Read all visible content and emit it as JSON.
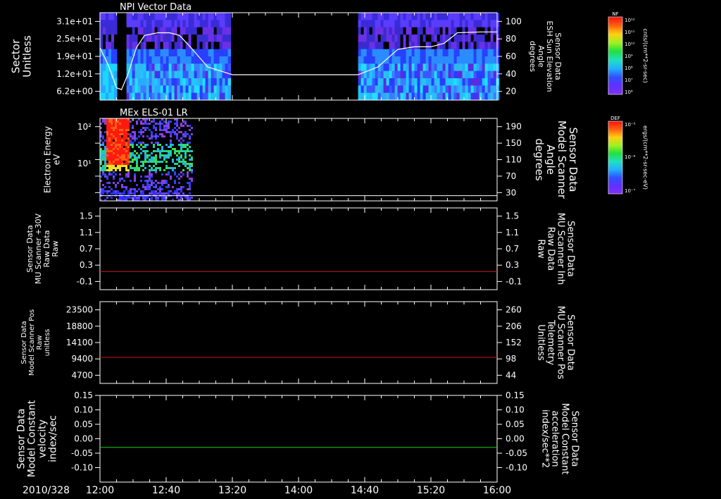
{
  "date_label": "2010/328",
  "time_ticks": [
    "12:00",
    "12:40",
    "13:20",
    "14:00",
    "14:40",
    "15:20",
    "16:00"
  ],
  "colors": {
    "frame": "#ffffff",
    "red_line": "#d01818",
    "green_line": "#10d010",
    "red_label": "#ff2020",
    "green_label": "#20e020"
  },
  "colorbars": [
    {
      "name": "npi-colorbar",
      "tag": "NF",
      "label": "cnts/(cm**2-sr-sec)",
      "ticks": [
        "10¹²",
        "10¹¹",
        "10¹⁰",
        "10⁹",
        "10⁸",
        "10⁷",
        "10⁶"
      ]
    },
    {
      "name": "els-colorbar",
      "tag": "DEF",
      "label": "ergs/(cm**2-sr-sec-eV)",
      "ticks": [
        "10⁻⁵",
        "10⁻⁶",
        "10⁻⁷"
      ]
    }
  ],
  "chart_data": [
    {
      "id": "npi-panel",
      "type": "heatmap",
      "title": "NPI Vector Data",
      "ylabel": [
        "Sector",
        "Unitless"
      ],
      "yticks": [
        "3.1e+01",
        "2.5e+01",
        "1.9e+01",
        "1.2e+01",
        "6.2e+00"
      ],
      "right_axis": {
        "label": [
          "Sensor Data",
          "ESH Sun Elevation",
          "Angle",
          "degrees"
        ],
        "ticks": [
          "100",
          "80",
          "60",
          "40",
          "20"
        ],
        "ylim": [
          0,
          100
        ]
      },
      "data_coverage": [
        [
          "12:00",
          "12:09"
        ],
        [
          "12:16",
          "13:18"
        ],
        [
          "14:36",
          "16:00"
        ]
      ],
      "series": [
        {
          "name": "sun-elevation",
          "x": [
            "12:00",
            "12:05",
            "12:10",
            "12:13",
            "12:17",
            "12:22",
            "12:27",
            "12:35",
            "12:42",
            "12:48",
            "12:55",
            "13:05",
            "13:20",
            "13:40",
            "14:00",
            "14:20",
            "14:36",
            "14:48",
            "15:00",
            "15:10",
            "15:20",
            "15:28",
            "15:36",
            "15:50",
            "16:00"
          ],
          "y": [
            60,
            40,
            14,
            12,
            30,
            60,
            74,
            77,
            77,
            74,
            60,
            38,
            29,
            29,
            29,
            29,
            29,
            38,
            58,
            61,
            61,
            65,
            77,
            78,
            78
          ]
        }
      ]
    },
    {
      "id": "els-panel",
      "type": "heatmap",
      "title": "MEx ELS-01 LR",
      "ylabel": [
        "Electron Energy",
        "eV"
      ],
      "yticks": [
        "10²",
        "10¹"
      ],
      "yscale": "log",
      "right_axis": {
        "label": [
          "Sensor Data",
          "Model Scanner",
          "Angle",
          "degrees"
        ],
        "ticks": [
          "190",
          "150",
          "110",
          "70",
          "30"
        ],
        "ylim": [
          0,
          190
        ]
      },
      "data_coverage": [
        [
          "12:00",
          "12:56"
        ]
      ],
      "series": [
        {
          "name": "scanner-angle",
          "x": [
            "12:00",
            "16:00"
          ],
          "y": [
            12,
            12
          ]
        }
      ]
    },
    {
      "id": "mu-raw-panel",
      "type": "line",
      "ylabel": [
        "Sensor Data",
        "MU Scanner +30V",
        "Raw Data",
        "Raw"
      ],
      "yticks": [
        "1.5",
        "1.1",
        "0.7",
        "0.3",
        "-0.1"
      ],
      "ylim": [
        -0.3,
        1.5
      ],
      "right_axis": {
        "label": [
          "Sensor Data",
          "MU Scanner Inh",
          "Raw Data",
          "Raw"
        ],
        "ticks": [
          "1.5",
          "1.1",
          "0.7",
          "0.3",
          "-0.1"
        ],
        "ylim": [
          -0.3,
          1.5
        ]
      },
      "series": [
        {
          "name": "mu-scanner-inh",
          "x": [
            "12:00",
            "16:00"
          ],
          "y": [
            0.1,
            0.1
          ]
        }
      ]
    },
    {
      "id": "scanner-pos-panel",
      "type": "line",
      "ylabel": [
        "Sensor Data",
        "Model Scanner Pos",
        "Raw",
        "unitless"
      ],
      "yticks": [
        "23500",
        "18800",
        "14100",
        "9400",
        "4700"
      ],
      "ylim": [
        0,
        23500
      ],
      "right_axis": {
        "label": [
          "Sensor Data",
          "MU Scanner Pos",
          "Telemetry",
          "Unitless"
        ],
        "ticks": [
          "260",
          "206",
          "152",
          "98",
          "44"
        ],
        "ylim": [
          0,
          260
        ]
      },
      "series": [
        {
          "name": "scanner-pos-telemetry",
          "x": [
            "12:00",
            "16:00"
          ],
          "y": [
            83,
            83
          ]
        }
      ]
    },
    {
      "id": "constant-panel",
      "type": "line",
      "ylabel": [
        "Sensor Data",
        "Model Constant",
        "velocity",
        "index/sec"
      ],
      "yticks": [
        "0.15",
        "0.10",
        "0.05",
        "0.00",
        "-0.05",
        "-0.10"
      ],
      "ylim": [
        -0.1,
        0.15
      ],
      "right_axis": {
        "label": [
          "Sensor Data",
          "Model Constant",
          "acceleration",
          "index/sec**2"
        ],
        "ticks": [
          "0.15",
          "0.10",
          "0.05",
          "0.00",
          "-0.05",
          "-0.10"
        ],
        "ylim": [
          -0.1,
          0.15
        ]
      },
      "series": [
        {
          "name": "model-constant-velocity",
          "x": [
            "12:00",
            "16:00"
          ],
          "y": [
            0.0,
            0.0
          ]
        }
      ]
    }
  ]
}
